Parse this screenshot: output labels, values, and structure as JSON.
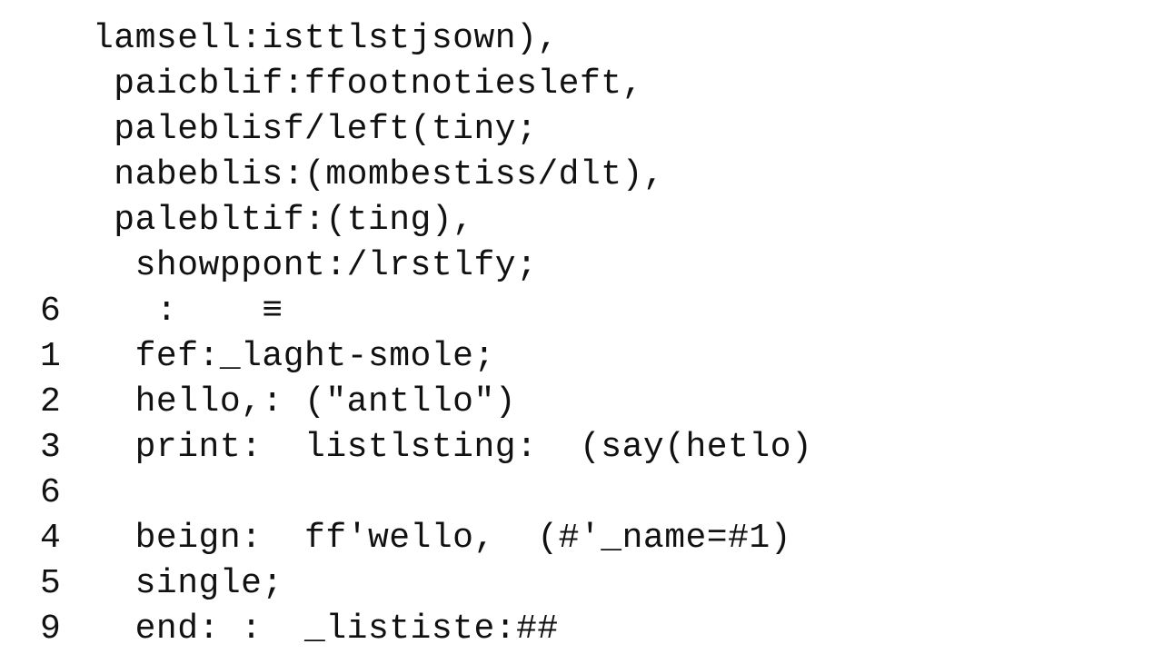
{
  "lines": [
    {
      "gutter": "",
      "indent": "",
      "text": "lamsell:isttlstjsown),"
    },
    {
      "gutter": "",
      "indent": " ",
      "text": "paicblif:ffootnotiesleft,"
    },
    {
      "gutter": "",
      "indent": " ",
      "text": "paleblisf/left(tiny;"
    },
    {
      "gutter": "",
      "indent": " ",
      "text": "nabeblis:(mombestiss/dlt),"
    },
    {
      "gutter": "",
      "indent": " ",
      "text": "palebltif:(ting),"
    },
    {
      "gutter": "",
      "indent": "  ",
      "text": "showppont:/lrstlfy;"
    },
    {
      "gutter": "6",
      "indent": "  ",
      "text": " :    ≡"
    },
    {
      "gutter": "1",
      "indent": "  ",
      "text": "fef:_laght-smole;"
    },
    {
      "gutter": "2",
      "indent": "  ",
      "text": "hello,: (\"antllo\")"
    },
    {
      "gutter": "3",
      "indent": "  ",
      "text": "print:  listlsting:  (say(hetlo)"
    },
    {
      "gutter": "6",
      "indent": "  ",
      "text": ""
    },
    {
      "gutter": "4",
      "indent": "  ",
      "text": "beign:  ff'wello,  (#'_name=#1)"
    },
    {
      "gutter": "5",
      "indent": "  ",
      "text": "single;"
    },
    {
      "gutter": "9",
      "indent": "  ",
      "text": "end: :  _lististe:##"
    }
  ]
}
